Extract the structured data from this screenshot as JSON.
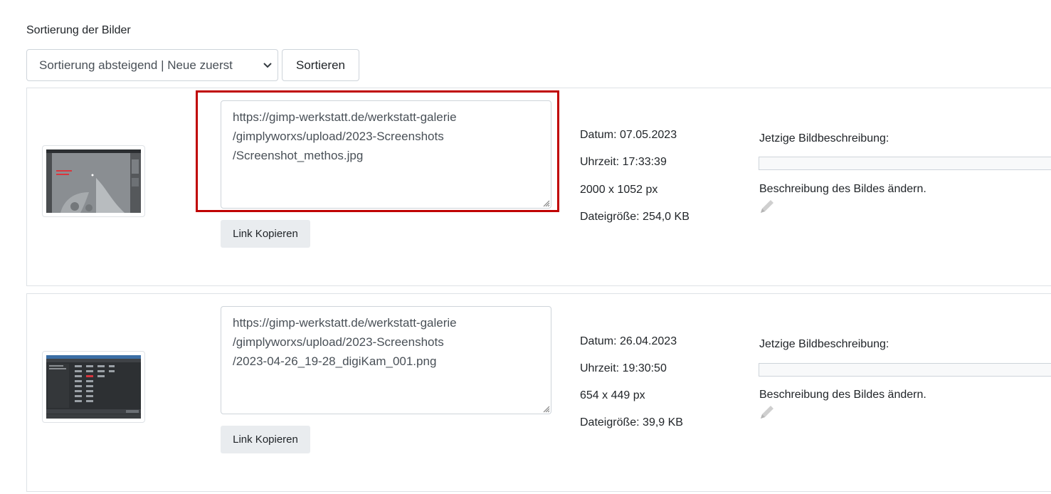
{
  "sort": {
    "heading": "Sortierung der Bilder",
    "selected": "Sortierung absteigend | Neue zuerst",
    "button_label": "Sortieren"
  },
  "images": [
    {
      "url": "https://gimp-werkstatt.de/werkstatt-galerie\n/gimplyworxs/upload/2023-Screenshots\n/Screenshot_methos.jpg",
      "copy_label": "Link Kopieren",
      "date": "Datum: 07.05.2023",
      "time": "Uhrzeit: 17:33:39",
      "dimensions": "2000 x 1052 px",
      "filesize": "Dateigröße: 254,0 KB",
      "current_desc_label": "Jetzige Bildbeschreibung:",
      "current_desc_value": "",
      "change_desc_label": "Beschreibung des Bildes ändern.",
      "edit_icon": "pencil-icon",
      "highlighted": true
    },
    {
      "url": "https://gimp-werkstatt.de/werkstatt-galerie\n/gimplyworxs/upload/2023-Screenshots\n/2023-04-26_19-28_digiKam_001.png",
      "copy_label": "Link Kopieren",
      "date": "Datum: 26.04.2023",
      "time": "Uhrzeit: 19:30:50",
      "dimensions": "654 x 449 px",
      "filesize": "Dateigröße: 39,9 KB",
      "current_desc_label": "Jetzige Bildbeschreibung:",
      "current_desc_value": "",
      "change_desc_label": "Beschreibung des Bildes ändern.",
      "edit_icon": "pencil-icon",
      "highlighted": false
    }
  ],
  "colors": {
    "highlight_border": "#c00000",
    "button_bg": "#e9ecef",
    "border": "#ced4da"
  }
}
